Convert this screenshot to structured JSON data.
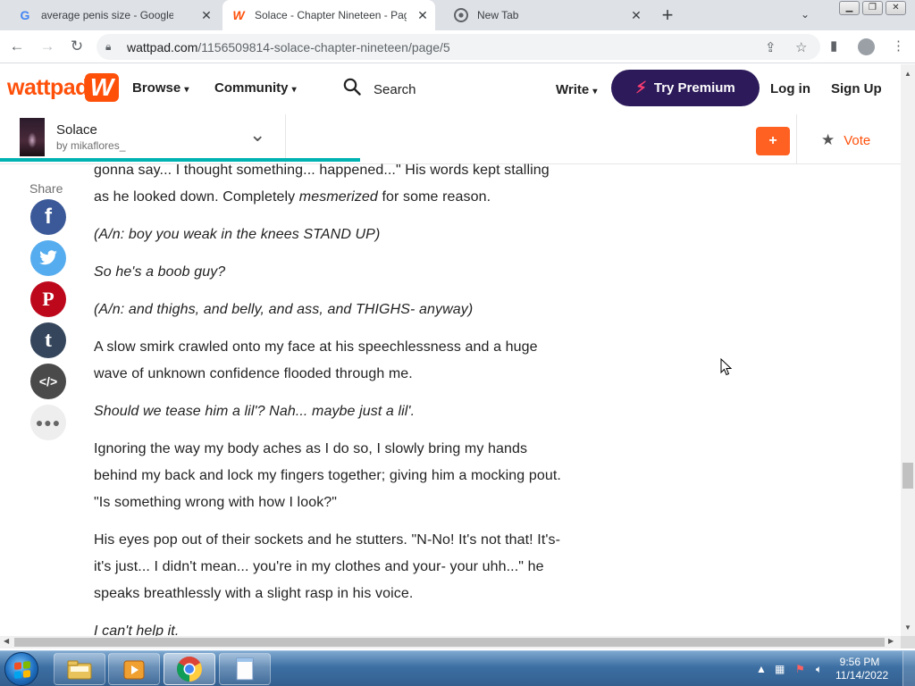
{
  "browser": {
    "tabs": [
      {
        "title": "average penis size - Google Sear",
        "favicon": "G",
        "active": false
      },
      {
        "title": "Solace - Chapter Nineteen - Page",
        "favicon": "W",
        "active": true
      },
      {
        "title": "New Tab",
        "favicon": "chrome",
        "active": false
      }
    ],
    "url_host": "wattpad.com",
    "url_path": "/1156509814-solace-chapter-nineteen/page/5"
  },
  "header": {
    "logo": "wattpad",
    "logo_mark": "W",
    "browse": "Browse",
    "community": "Community",
    "search": "Search",
    "write": "Write",
    "try_premium": "Try Premium",
    "login": "Log in",
    "signup": "Sign Up"
  },
  "story": {
    "title": "Solace",
    "author": "by mikaflores_",
    "add_label": "+",
    "vote": "Vote",
    "reading_progress": 0.4
  },
  "share": {
    "label": "Share",
    "buttons": [
      {
        "name": "facebook",
        "glyph": "f",
        "color": "#3b5998"
      },
      {
        "name": "twitter",
        "glyph": "t",
        "color": "#55acee"
      },
      {
        "name": "pinterest",
        "glyph": "P",
        "color": "#bd081c"
      },
      {
        "name": "tumblr",
        "glyph": "t",
        "color": "#35465c"
      },
      {
        "name": "embed",
        "glyph": "</>",
        "color": "#4a4a4a"
      },
      {
        "name": "more",
        "glyph": "•••",
        "color": "#eeeeee"
      }
    ]
  },
  "content": {
    "paragraphs": [
      {
        "italic": false,
        "html": "gonna say... I thought something... happened...\" His words kept stalling as he looked down. Completely <em>mesmerized</em> for some reason."
      },
      {
        "italic": true,
        "html": "(A/n: boy you weak in the knees STAND UP)"
      },
      {
        "italic": true,
        "html": "So he's a boob guy?"
      },
      {
        "italic": true,
        "html": "(A/n: and thighs, and belly, and ass, and THIGHS- anyway)"
      },
      {
        "italic": false,
        "html": "A slow smirk crawled onto my face at his speechlessness and a huge wave of unknown confidence flooded through me."
      },
      {
        "italic": true,
        "html": "Should we tease him a lil'? Nah... maybe just a lil'."
      },
      {
        "italic": false,
        "html": "Ignoring the way my body aches as I do so, I slowly bring my hands behind my back and lock my fingers together; giving him a mocking pout. \"Is something wrong with how I look?\""
      },
      {
        "italic": false,
        "html": "His eyes pop out of their sockets and he stutters. \"N-No! It's not that! It's- it's just... I didn't mean... you're in my clothes and your- your uhh...\" he speaks breathlessly with a slight rasp in his voice."
      },
      {
        "italic": true,
        "html": "I can't help it."
      }
    ]
  },
  "taskbar": {
    "time": "9:56 PM",
    "date": "11/14/2022",
    "apps": [
      "explorer",
      "media-player",
      "chrome",
      "notepad"
    ]
  },
  "colors": {
    "brand": "#ff500a",
    "premium": "#2c1a5a",
    "progress": "#00b2b2"
  }
}
